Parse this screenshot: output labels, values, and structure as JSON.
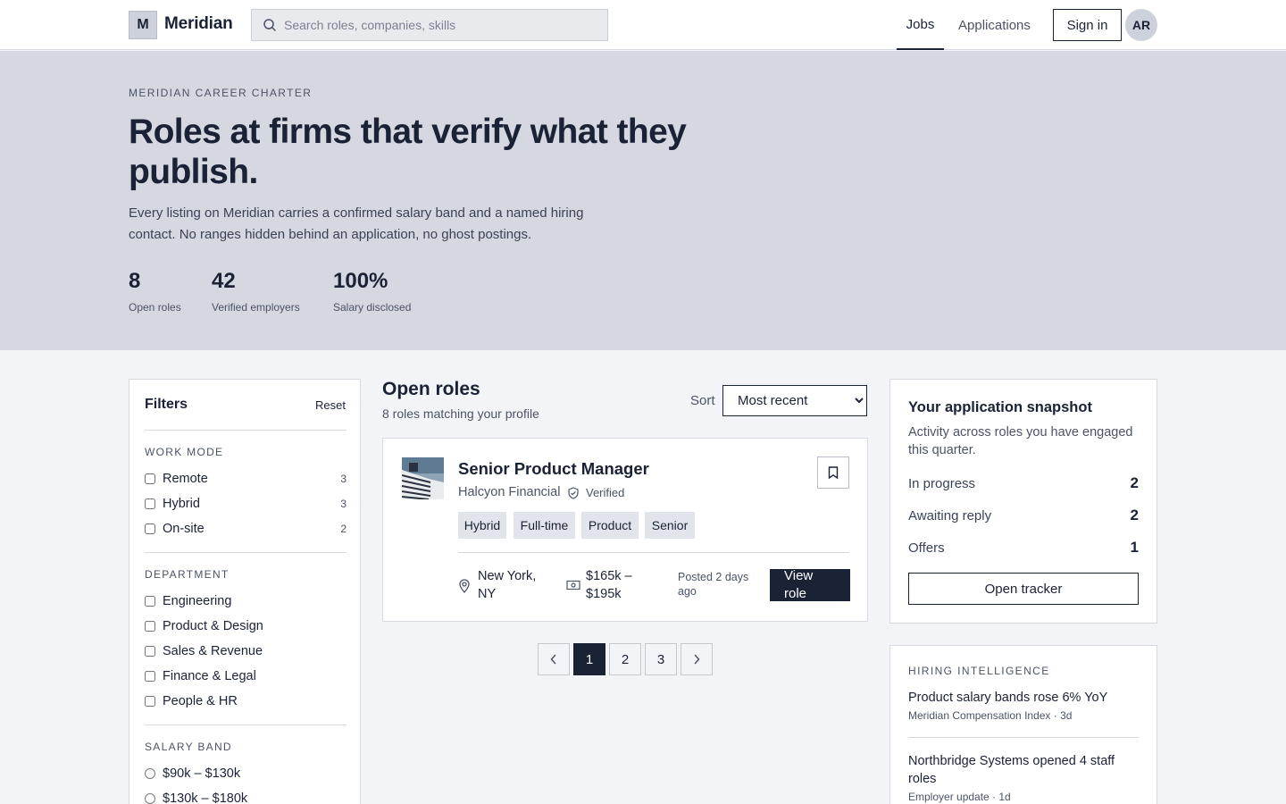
{
  "header": {
    "logo_letter": "M",
    "brand": "Meridian",
    "search_placeholder": "Search roles, companies, skills",
    "nav": [
      {
        "label": "Jobs",
        "active": true
      },
      {
        "label": "Applications",
        "active": false
      }
    ],
    "signin_label": "Sign in",
    "avatar_initials": "AR"
  },
  "hero": {
    "eyebrow": "MERIDIAN CAREER CHARTER",
    "title": "Roles at firms that verify what they publish.",
    "description": "Every listing on Meridian carries a confirmed salary band and a named hiring contact. No ranges hidden behind an application, no ghost postings.",
    "stats": [
      {
        "value": "8",
        "label": "Open roles"
      },
      {
        "value": "42",
        "label": "Verified employers"
      },
      {
        "value": "100%",
        "label": "Salary disclosed"
      }
    ]
  },
  "filters": {
    "title": "Filters",
    "reset_label": "Reset",
    "work_mode": {
      "title": "WORK MODE",
      "options": [
        {
          "label": "Remote",
          "count": "3"
        },
        {
          "label": "Hybrid",
          "count": "3"
        },
        {
          "label": "On-site",
          "count": "2"
        }
      ]
    },
    "department": {
      "title": "DEPARTMENT",
      "options": [
        {
          "label": "Engineering"
        },
        {
          "label": "Product & Design"
        },
        {
          "label": "Sales & Revenue"
        },
        {
          "label": "Finance & Legal"
        },
        {
          "label": "People & HR"
        }
      ]
    },
    "salary_band": {
      "title": "SALARY BAND",
      "options": [
        {
          "label": "$90k – $130k"
        },
        {
          "label": "$130k – $180k"
        }
      ]
    }
  },
  "results": {
    "title": "Open roles",
    "subtitle": "8 roles matching your profile",
    "sort_label": "Sort",
    "sort_value": "Most recent",
    "jobs": [
      {
        "title": "Senior Product Manager",
        "company": "Halcyon Financial",
        "verified_label": "Verified",
        "tags": [
          "Hybrid",
          "Full-time",
          "Product",
          "Senior"
        ],
        "location": "New York, NY",
        "salary": "$165k – $195k",
        "posted": "Posted 2 days ago",
        "cta": "View role"
      }
    ],
    "pagination": {
      "pages": [
        "1",
        "2",
        "3"
      ],
      "current": "1",
      "prev_icon": "chevron-left-icon",
      "next_icon": "chevron-right-icon"
    }
  },
  "snapshot": {
    "title": "Your application snapshot",
    "description": "Activity across roles you have engaged this quarter.",
    "rows": [
      {
        "label": "In progress",
        "value": "2"
      },
      {
        "label": "Awaiting reply",
        "value": "2"
      },
      {
        "label": "Offers",
        "value": "1"
      }
    ],
    "button_label": "Open tracker"
  },
  "intelligence": {
    "title": "HIRING INTELLIGENCE",
    "items": [
      {
        "headline": "Product salary bands rose 6% YoY",
        "meta": "Meridian Compensation Index · 3d"
      },
      {
        "headline": "Northbridge Systems opened 4 staff roles",
        "meta": "Employer update · 1d"
      }
    ]
  },
  "colors": {
    "primary": "#1a2236",
    "hero_bg": "#d5d8e0",
    "page_bg": "#f3f4f7",
    "tag_bg": "#e1e4ea"
  }
}
